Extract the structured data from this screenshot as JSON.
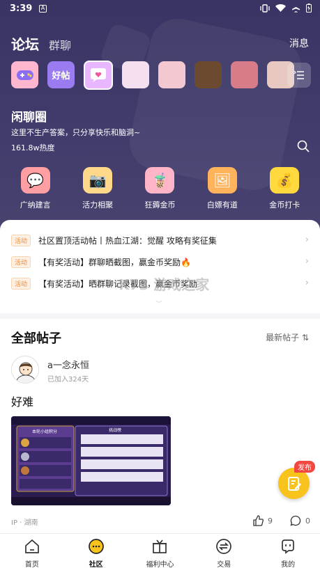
{
  "status_bar": {
    "time": "3:39"
  },
  "header": {
    "tabs": [
      {
        "label": "论坛",
        "active": true
      },
      {
        "label": "群聊",
        "active": false
      }
    ],
    "messages_label": "消息"
  },
  "circles": [
    {
      "name": "game-circle",
      "text": "",
      "color": "#ffb7cf"
    },
    {
      "name": "haotie-circle",
      "text": "好帖",
      "color": "#9a7cf0"
    },
    {
      "name": "chat-circle",
      "text": "",
      "color": "#e9b7ff"
    },
    {
      "name": "game-a",
      "text": "",
      "color": "#f4e0ef"
    },
    {
      "name": "game-b",
      "text": "",
      "color": "#f3c8d0"
    },
    {
      "name": "game-c",
      "text": "",
      "color": "#6b4a2f"
    },
    {
      "name": "game-d",
      "text": "",
      "color": "#d87c8a"
    },
    {
      "name": "game-e",
      "text": "",
      "color": "#e7c9c2"
    }
  ],
  "circle_info": {
    "title": "闲聊圈",
    "description": "这里不生产答案，只分享快乐和脑洞~",
    "heat": "161.8w热度"
  },
  "features": [
    {
      "label": "广纳建言",
      "icon": "💬",
      "color": "#ff9ea3"
    },
    {
      "label": "活力相聚",
      "icon": "📷",
      "color": "#ffd88a"
    },
    {
      "label": "狂薅金币",
      "icon": "🧋",
      "color": "#ffb4c8"
    },
    {
      "label": "白嫖有道",
      "icon": "🖼",
      "color": "#ffb35a"
    },
    {
      "label": "金币打卡",
      "icon": "💰",
      "color": "#ffd93d"
    }
  ],
  "announcements": [
    {
      "tag": "活动",
      "text": "社区置顶活动帖丨热血江湖：觉醒 攻略有奖征集"
    },
    {
      "tag": "活动",
      "text": "【有奖活动】群聊晒截图，赢金币奖励🔥"
    },
    {
      "tag": "活动",
      "text": "【有奖活动】晒群聊记录截图，赢金币奖励"
    }
  ],
  "feed": {
    "section_title": "全部帖子",
    "sort_label": "最新帖子"
  },
  "post": {
    "username": "a一念永恒",
    "joined": "已加入324天",
    "title": "好难",
    "ip": "IP · 湖南",
    "likes": "9",
    "comments": "0",
    "image_caption": "本轮小组积分",
    "image_tab": "挑战榜"
  },
  "fab": {
    "badge": "发布"
  },
  "bottom_nav": [
    {
      "label": "首页",
      "active": false
    },
    {
      "label": "社区",
      "active": true
    },
    {
      "label": "福利中心",
      "active": false
    },
    {
      "label": "交易",
      "active": false
    },
    {
      "label": "我的",
      "active": false
    }
  ],
  "watermark": "K73 游戏之家"
}
